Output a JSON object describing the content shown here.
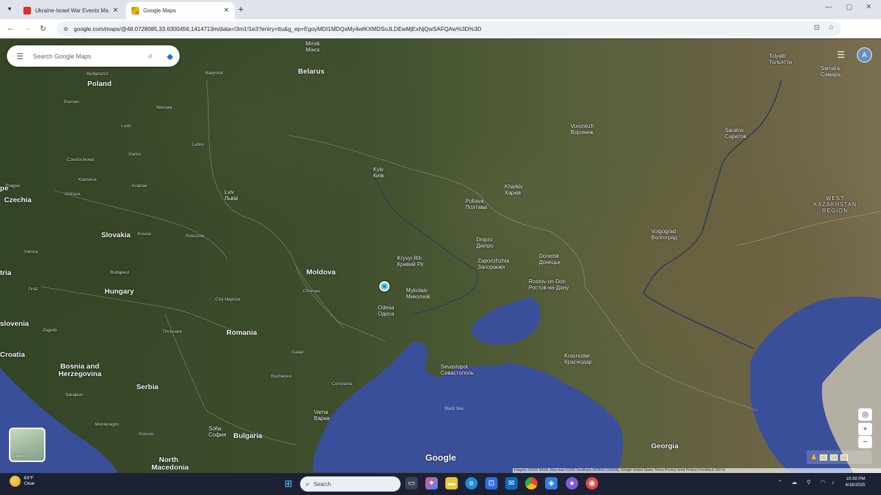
{
  "browser": {
    "tabs": [
      {
        "title": "Ukraine-Israel War Events Map",
        "active": false,
        "favicon_color": "#d93025"
      },
      {
        "title": "Google Maps",
        "active": true,
        "favicon_color": "#34a853"
      }
    ],
    "url": "google.com/maps/@48.0728085,33.6300456,1414713m/data=!3m1!1e3?entry=ttu&g_ep=EgoyMDI1MDQxMy4wIKXMDSoJLDEwMjExNjQwSAFQAw%3D%3D"
  },
  "search": {
    "placeholder": "Search Google Maps"
  },
  "map": {
    "mode": "satellite",
    "labels": {
      "countries": [
        "Belarus",
        "Poland",
        "Czechia",
        "Slovakia",
        "Hungary",
        "Moldova",
        "Romania",
        "Croatia",
        "Bosnia and Herzegovina",
        "Serbia",
        "Bulgaria",
        "Georgia",
        "North Macedonia",
        "slovenia",
        "tria",
        "pe"
      ],
      "cities": [
        {
          "name": "Minsk",
          "local": "Мінск"
        },
        {
          "name": "Kyiv",
          "local": "Київ"
        },
        {
          "name": "Kharkiv",
          "local": "Харків"
        },
        {
          "name": "Poltava",
          "local": "Полтава"
        },
        {
          "name": "Dnipro",
          "local": "Дніпро"
        },
        {
          "name": "Kryvyi Rih",
          "local": "Кривий Ріг"
        },
        {
          "name": "Zaporizhzhia",
          "local": "Запоріжжя"
        },
        {
          "name": "Donetsk",
          "local": "Донецьк"
        },
        {
          "name": "Mykolaiv",
          "local": "Миколаїв"
        },
        {
          "name": "Odesa",
          "local": "Одеса"
        },
        {
          "name": "Lviv",
          "local": "Львів"
        },
        {
          "name": "Voronezh",
          "local": "Воронеж"
        },
        {
          "name": "Rostov-on-Don",
          "local": "Ростов-на-Дону"
        },
        {
          "name": "Volgograd",
          "local": "Волгоград"
        },
        {
          "name": "Saratov",
          "local": "Саратов"
        },
        {
          "name": "Samara",
          "local": "Самара"
        },
        {
          "name": "Tolyatti",
          "local": "Тольятти"
        },
        {
          "name": "Krasnodar",
          "local": "Краснодар"
        },
        {
          "name": "Sevastopol",
          "local": "Севастополь"
        },
        {
          "name": "Varna",
          "local": "Варна"
        },
        {
          "name": "Sofia",
          "local": "София"
        },
        {
          "name": "Budapest",
          "local": ""
        },
        {
          "name": "Bucharest",
          "local": ""
        },
        {
          "name": "Chisinau",
          "local": ""
        },
        {
          "name": "Warsaw",
          "local": ""
        },
        {
          "name": "Krakow",
          "local": ""
        },
        {
          "name": "Bialystok",
          "local": ""
        },
        {
          "name": "Lublin",
          "local": ""
        },
        {
          "name": "Cluj-Napoca",
          "local": ""
        },
        {
          "name": "Zagreb",
          "local": ""
        },
        {
          "name": "Sarajevo",
          "local": ""
        },
        {
          "name": "Kosovo",
          "local": ""
        },
        {
          "name": "Montenegro",
          "local": ""
        },
        {
          "name": "Vienna",
          "local": ""
        },
        {
          "name": "Prague",
          "local": ""
        },
        {
          "name": "Lodz",
          "local": ""
        },
        {
          "name": "Poznan",
          "local": ""
        },
        {
          "name": "Bydgoszcz",
          "local": ""
        },
        {
          "name": "Katowice",
          "local": ""
        },
        {
          "name": "Czestochowa",
          "local": ""
        },
        {
          "name": "Kielce",
          "local": ""
        },
        {
          "name": "Ostrava",
          "local": ""
        },
        {
          "name": "Graz",
          "local": ""
        },
        {
          "name": "Timisoara",
          "local": ""
        },
        {
          "name": "Galati",
          "local": ""
        },
        {
          "name": "Constanta",
          "local": ""
        },
        {
          "name": "Kosice",
          "local": ""
        },
        {
          "name": "Rzeszow",
          "local": ""
        }
      ],
      "regions": [
        {
          "name": "WEST KAZAKHSTAN REGION"
        }
      ],
      "seas": [
        "Black Sea"
      ]
    }
  },
  "layers": {
    "label": "Layers"
  },
  "controls": {
    "zoom_in": "+",
    "zoom_out": "−",
    "locate": "◎"
  },
  "google_logo": "Google",
  "attribution": "Imagery ©2025 NASA, Map data ©2025 GeoBasis-DE/BKG (©2009), Google   United States   Terms   Privacy   Send Product Feedback   100 mi",
  "taskbar": {
    "weather_temp": "83°F",
    "weather_desc": "Clear",
    "search_placeholder": "Search",
    "time": "10:30 PM",
    "date": "4/18/2025"
  }
}
